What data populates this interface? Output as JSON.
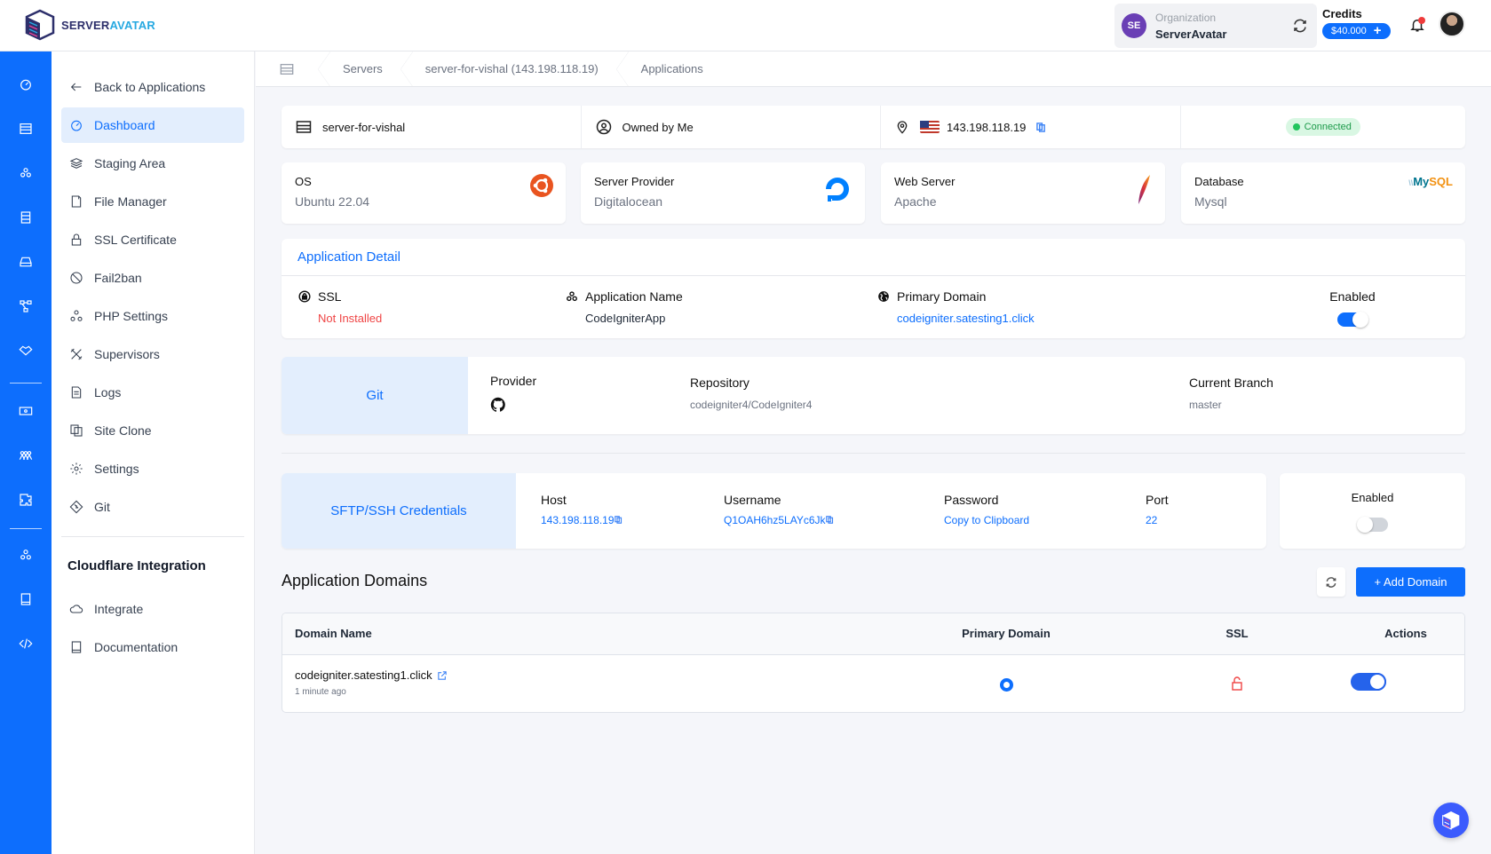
{
  "brand": {
    "part1": "SERVER",
    "part2": "AVATAR"
  },
  "header": {
    "organization_label": "Organization",
    "organization_name": "ServerAvatar",
    "organization_initials": "SE",
    "credits_label": "Credits",
    "credits_amount": "$40.000",
    "credits_plus": "+"
  },
  "rail": {
    "icons": [
      "dashboard-icon",
      "servers-icon",
      "applications-icon",
      "database-icon",
      "storage-icon",
      "network-icon",
      "handshake-icon",
      "billing-icon",
      "team-icon",
      "integrations-icon",
      "apps-icon",
      "book-icon",
      "code-icon"
    ]
  },
  "nav": {
    "back_label": "Back to Applications",
    "items": [
      {
        "label": "Dashboard",
        "icon": "dashboard-icon",
        "active": true
      },
      {
        "label": "Staging Area",
        "icon": "layers-icon"
      },
      {
        "label": "File Manager",
        "icon": "file-icon"
      },
      {
        "label": "SSL Certificate",
        "icon": "lock-icon"
      },
      {
        "label": "Fail2ban",
        "icon": "ban-icon"
      },
      {
        "label": "PHP Settings",
        "icon": "php-settings-icon"
      },
      {
        "label": "Supervisors",
        "icon": "tools-icon"
      },
      {
        "label": "Logs",
        "icon": "log-icon"
      },
      {
        "label": "Site Clone",
        "icon": "clone-icon"
      },
      {
        "label": "Settings",
        "icon": "gear-icon"
      },
      {
        "label": "Git",
        "icon": "git-icon"
      }
    ],
    "section_title": "Cloudflare Integration",
    "section_items": [
      {
        "label": "Integrate",
        "icon": "cloud-icon"
      },
      {
        "label": "Documentation",
        "icon": "book-icon"
      }
    ]
  },
  "breadcrumb": [
    "Servers",
    "server-for-vishal (143.198.118.19)",
    "Applications"
  ],
  "server_info": {
    "name": "server-for-vishal",
    "ownership": "Owned by Me",
    "ip": "143.198.118.19",
    "status": "Connected",
    "status_color": "#22c55e"
  },
  "stats": [
    {
      "label": "OS",
      "value": "Ubuntu 22.04",
      "icon": "ubuntu-icon"
    },
    {
      "label": "Server Provider",
      "value": "Digitalocean",
      "icon": "digitalocean-icon"
    },
    {
      "label": "Web Server",
      "value": "Apache",
      "icon": "apache-feather-icon"
    },
    {
      "label": "Database",
      "value": "Mysql",
      "icon": "mysql-icon",
      "logo_text_1": "My",
      "logo_text_2": "SQL"
    }
  ],
  "app_detail": {
    "title": "Application Detail",
    "ssl_label": "SSL",
    "ssl_value": "Not Installed",
    "app_name_label": "Application Name",
    "app_name_value": "CodeIgniterApp",
    "domain_label": "Primary Domain",
    "domain_value": "codeigniter.satesting1.click",
    "enabled_label": "Enabled",
    "enabled": true
  },
  "git": {
    "label": "Git",
    "provider_label": "Provider",
    "provider_icon": "github-icon",
    "repo_label": "Repository",
    "repo_value": "codeigniter4/CodeIgniter4",
    "branch_label": "Current Branch",
    "branch_value": "master"
  },
  "sftp": {
    "label": "SFTP/SSH Credentials",
    "host_label": "Host",
    "host_value": "143.198.118.19",
    "username_label": "Username",
    "username_value": "Q1OAH6hz5LAYc6Jk",
    "password_label": "Password",
    "password_value": "Copy to Clipboard",
    "port_label": "Port",
    "port_value": "22",
    "enabled_label": "Enabled",
    "enabled": false
  },
  "domains": {
    "title": "Application Domains",
    "add_label": "+ Add Domain",
    "columns": [
      "Domain Name",
      "Primary Domain",
      "SSL",
      "Actions"
    ],
    "rows": [
      {
        "domain": "codeigniter.satesting1.click",
        "time": "1 minute ago",
        "primary": true,
        "ssl": false,
        "enabled": true
      }
    ]
  },
  "colors": {
    "accent": "#0d6efd",
    "danger": "#ef4444",
    "success": "#22c55e"
  }
}
